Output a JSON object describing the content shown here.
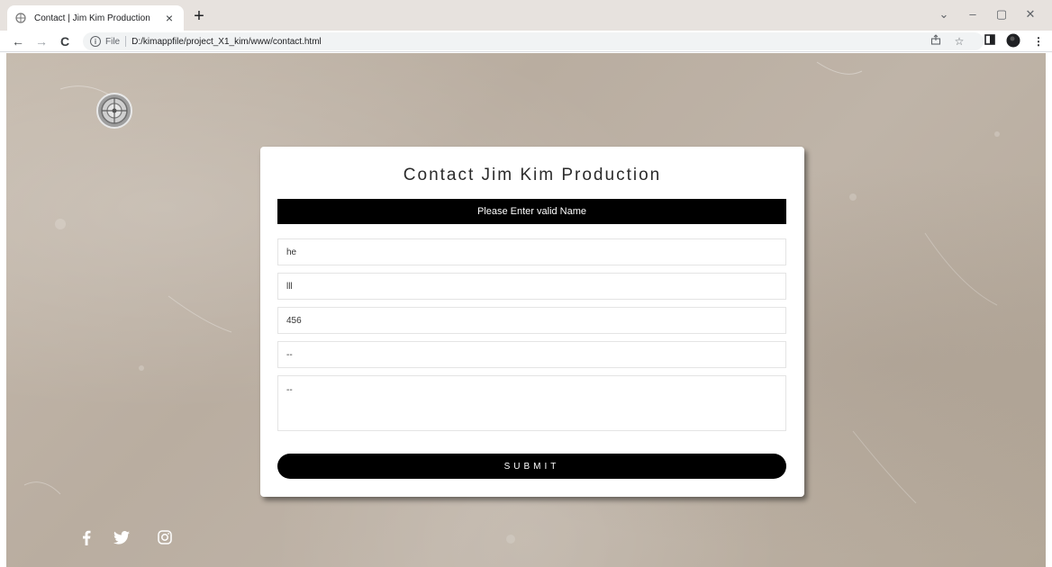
{
  "browser": {
    "tab_title": "Contact | Jim Kim Production",
    "tab_close": "×",
    "new_tab": "+",
    "back": "←",
    "forward": "→",
    "reload": "C",
    "scheme_label": "File",
    "url": "D:/kimappfile/project_X1_kim/www/contact.html",
    "window_controls": {
      "chevron": "⌄",
      "minimize": "–",
      "restore": "▢",
      "close": "✕"
    }
  },
  "page": {
    "title": "Contact Jim Kim Production",
    "error_message": "Please Enter valid Name",
    "form": {
      "name_value": "he",
      "field2_value": "lll",
      "field3_value": "456",
      "field4_value": "--",
      "message_value": "--"
    },
    "submit_label": "SUBMIT"
  },
  "social": [
    "facebook-icon",
    "twitter-icon",
    "instagram-icon"
  ],
  "colors": {
    "background": "#bcb1a4",
    "card": "#ffffff",
    "accent": "#000000"
  }
}
